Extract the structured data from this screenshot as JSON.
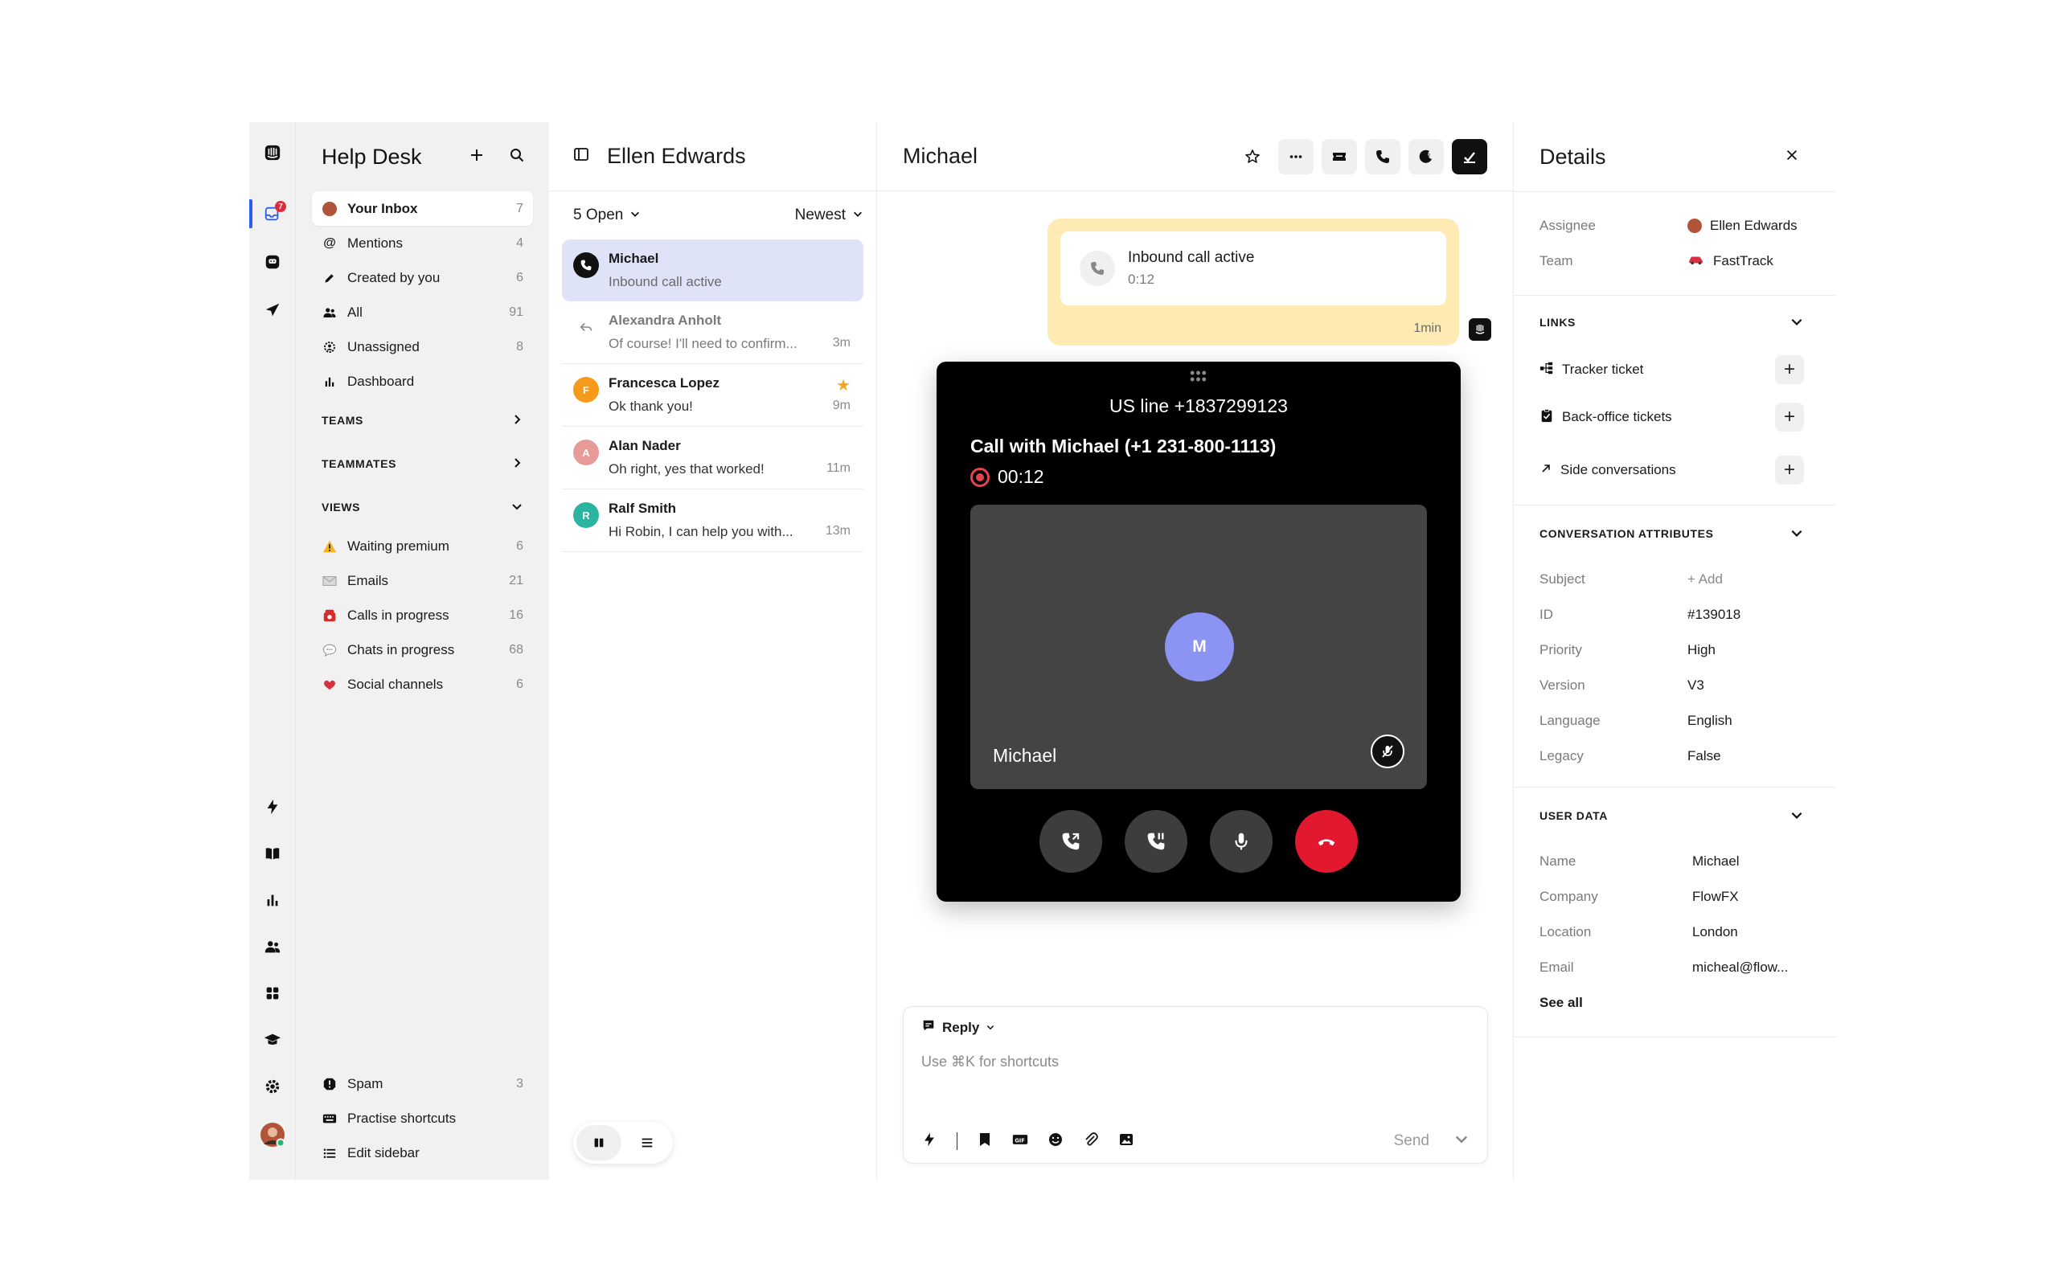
{
  "sidebar": {
    "title": "Help Desk",
    "inbox_items": [
      {
        "label": "Your Inbox",
        "count": "7",
        "icon": "avatar-icon"
      },
      {
        "label": "Mentions",
        "count": "4",
        "icon": "at-icon"
      },
      {
        "label": "Created by you",
        "count": "6",
        "icon": "pencil-icon"
      },
      {
        "label": "All",
        "count": "91",
        "icon": "people-icon"
      },
      {
        "label": "Unassigned",
        "count": "8",
        "icon": "unassigned-icon"
      },
      {
        "label": "Dashboard",
        "count": "",
        "icon": "bar-chart-icon"
      }
    ],
    "sections": {
      "teams": "TEAMS",
      "teammates": "TEAMMATES",
      "views": "VIEWS"
    },
    "views": [
      {
        "label": "Waiting premium",
        "count": "6",
        "icon": "warning-icon"
      },
      {
        "label": "Emails",
        "count": "21",
        "icon": "envelope-icon"
      },
      {
        "label": "Calls in progress",
        "count": "16",
        "icon": "phone-icon"
      },
      {
        "label": "Chats in progress",
        "count": "68",
        "icon": "speech-bubble-icon"
      },
      {
        "label": "Social channels",
        "count": "6",
        "icon": "heart-icon"
      }
    ],
    "bottom": [
      {
        "label": "Spam",
        "count": "3",
        "icon": "spam-icon"
      },
      {
        "label": "Practise shortcuts",
        "count": "",
        "icon": "keyboard-icon"
      },
      {
        "label": "Edit sidebar",
        "count": "",
        "icon": "list-icon"
      }
    ]
  },
  "rail": {
    "inbox_badge": "7"
  },
  "list": {
    "owner": "Ellen Edwards",
    "filter": "5 Open",
    "sort": "Newest",
    "conversations": [
      {
        "name": "Michael",
        "preview": "Inbound call active",
        "time": "",
        "avatar": "",
        "color": "#111111"
      },
      {
        "name": "Alexandra Anholt",
        "preview": "Of course! I'll need to confirm...",
        "time": "3m",
        "avatar": "",
        "color": "#ffffff"
      },
      {
        "name": "Francesca Lopez",
        "preview": "Ok thank you!",
        "time": "9m",
        "avatar": "F",
        "color": "#f59a1b"
      },
      {
        "name": "Alan Nader",
        "preview": "Oh right, yes that worked!",
        "time": "11m",
        "avatar": "A",
        "color": "#e79a98"
      },
      {
        "name": "Ralf Smith",
        "preview": "Hi Robin, I can help you with...",
        "time": "13m",
        "avatar": "R",
        "color": "#2bb5a0"
      }
    ]
  },
  "main": {
    "title": "Michael",
    "bubble": {
      "title": "Inbound call active",
      "duration": "0:12",
      "ago": "1min"
    },
    "call": {
      "line": "US line +1837299123",
      "with": "Call with Michael (+1 231-800-1113)",
      "timer": "00:12",
      "avatar_initial": "M",
      "caller_name": "Michael"
    },
    "composer": {
      "mode": "Reply",
      "placeholder": "Use ⌘K for shortcuts",
      "send": "Send"
    }
  },
  "details": {
    "title": "Details",
    "assignee_label": "Assignee",
    "assignee": "Ellen Edwards",
    "team_label": "Team",
    "team": "FastTrack",
    "links_title": "LINKS",
    "links": [
      "Tracker ticket",
      "Back-office tickets",
      "Side conversations"
    ],
    "attrs_title": "CONVERSATION ATTRIBUTES",
    "attrs": [
      {
        "k": "Subject",
        "v": "+ Add"
      },
      {
        "k": "ID",
        "v": "#139018"
      },
      {
        "k": "Priority",
        "v": "High"
      },
      {
        "k": "Version",
        "v": "V3"
      },
      {
        "k": "Language",
        "v": "English"
      },
      {
        "k": "Legacy",
        "v": "False"
      }
    ],
    "user_title": "USER DATA",
    "user": [
      {
        "k": "Name",
        "v": "Michael"
      },
      {
        "k": "Company",
        "v": "FlowFX"
      },
      {
        "k": "Location",
        "v": "London"
      },
      {
        "k": "Email",
        "v": "micheal@flow..."
      }
    ],
    "see_all": "See all"
  },
  "colors": {
    "accent": "#2c5ef0",
    "active_row": "#dfe3f8",
    "call_bubble": "#fdebb3",
    "end_call": "#e2182f",
    "avatar_m": "#8b93f3"
  }
}
